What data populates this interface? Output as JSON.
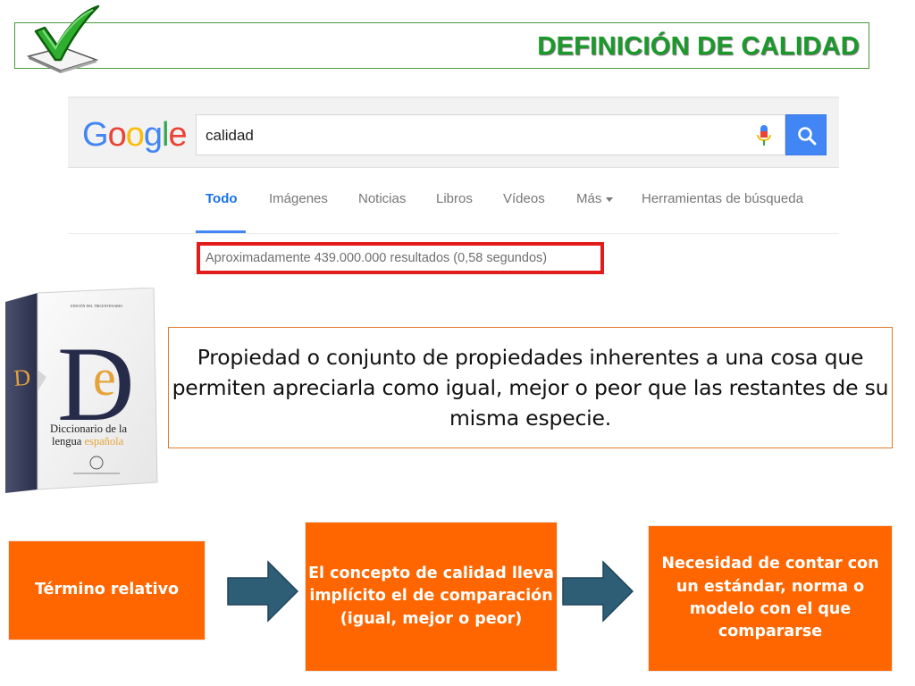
{
  "header": {
    "title": "DEFINICIÓN DE CALIDAD",
    "icon": "checkmark-icon"
  },
  "google": {
    "logo": [
      "G",
      "o",
      "o",
      "g",
      "l",
      "e"
    ],
    "logo_colors": [
      "#4285f4",
      "#ea4335",
      "#fbbc05",
      "#4285f4",
      "#34a853",
      "#ea4335"
    ],
    "query": "calidad",
    "tabs": [
      "Todo",
      "Imágenes",
      "Noticias",
      "Libros",
      "Vídeos",
      "Más",
      "Herramientas de búsqueda"
    ],
    "active_tab": "Todo",
    "results_text": "Aproximadamente 439.000.000 resultados (0,58 segundos)",
    "highlight_color": "#e21b1b"
  },
  "dictionary": {
    "cover_line1": "Diccionario de la",
    "cover_line2": "lengua",
    "cover_line3": "española"
  },
  "definition": {
    "text": "Propiedad o conjunto de propiedades inherentes a una cosa que permiten apreciarla como igual, mejor o peor que las restantes de su misma especie."
  },
  "flow": {
    "box1": "Término relativo",
    "box2": "El concepto de calidad lleva implícito el de comparación (igual, mejor o peor)",
    "box3": "Necesidad de contar con un estándar, norma o modelo con el que compararse",
    "box_color": "#ff6600",
    "arrow_color": "#2e5e76"
  }
}
